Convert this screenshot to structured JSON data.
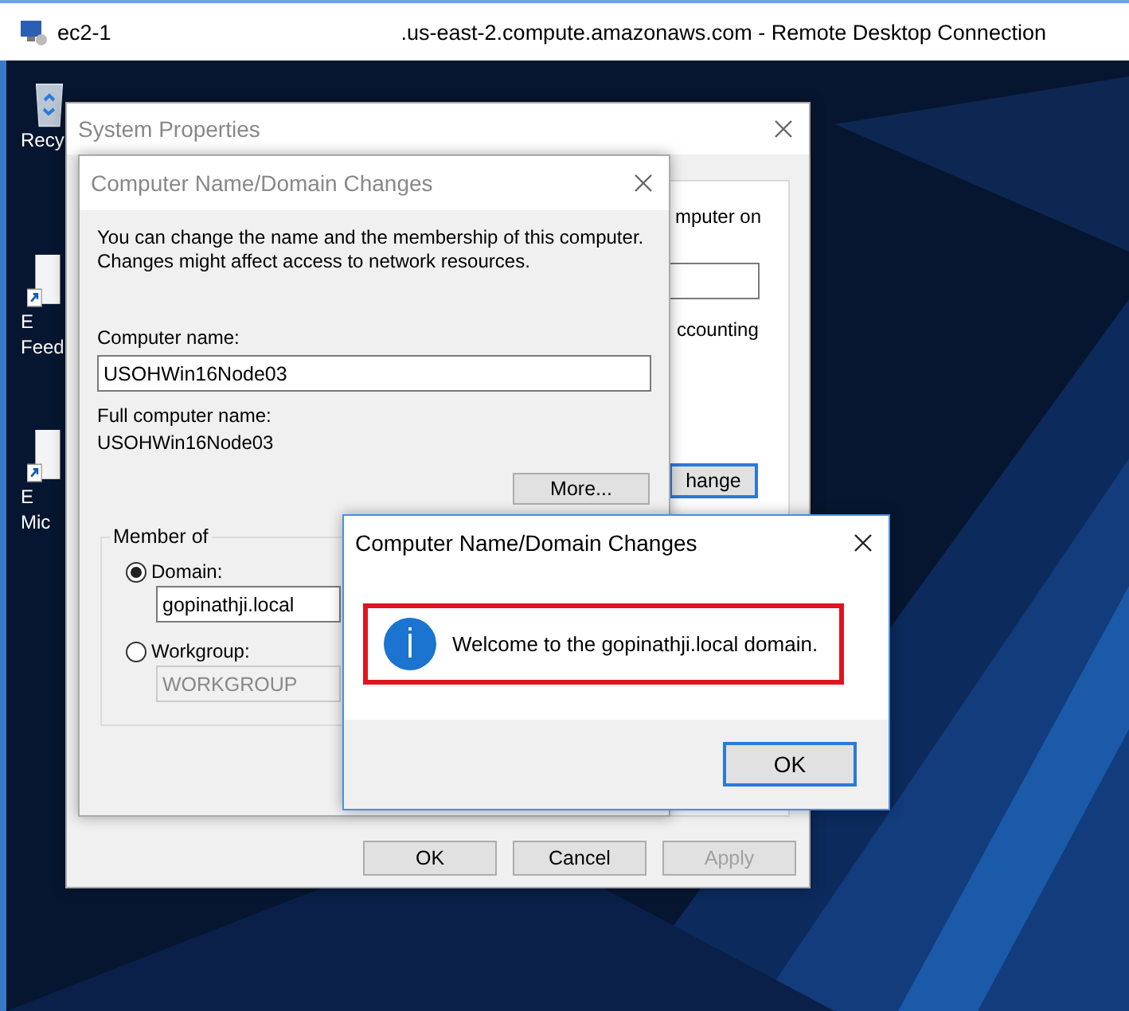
{
  "window": {
    "title_left": "ec2-1",
    "title_right": ".us-east-2.compute.amazonaws.com - Remote Desktop Connection"
  },
  "desktop_icons": [
    {
      "kind": "recycle-bin",
      "lines": [
        "Recy"
      ]
    },
    {
      "kind": "shortcut",
      "lines": [
        "E",
        "Feed"
      ]
    },
    {
      "kind": "shortcut",
      "lines": [
        "E",
        "Mic"
      ]
    }
  ],
  "system_properties": {
    "title": "System Properties",
    "text_fragment_1": "mputer on",
    "text_fragment_2": "ccounting",
    "change_button": "hange",
    "buttons": [
      {
        "label": "OK",
        "disabled": false
      },
      {
        "label": "Cancel",
        "disabled": false
      },
      {
        "label": "Apply",
        "disabled": true
      }
    ]
  },
  "name_dialog": {
    "title": "Computer Name/Domain Changes",
    "description_lines": [
      "You can change the name and the membership of this computer.",
      "Changes might affect access to network resources."
    ],
    "computer_name_label": "Computer name:",
    "computer_name_value": "USOHWin16Node03",
    "full_name_label": "Full computer name:",
    "full_name_value": "USOHWin16Node03",
    "more_button": "More...",
    "member_of": {
      "legend": "Member of",
      "options": [
        {
          "label": "Domain:",
          "selected": true,
          "value": "gopinathji.local",
          "disabled": false
        },
        {
          "label": "Workgroup:",
          "selected": false,
          "value": "WORKGROUP",
          "disabled": true
        }
      ]
    }
  },
  "message": {
    "title": "Computer Name/Domain Changes",
    "text": "Welcome to the gopinathji.local domain.",
    "ok_button": "OK"
  }
}
